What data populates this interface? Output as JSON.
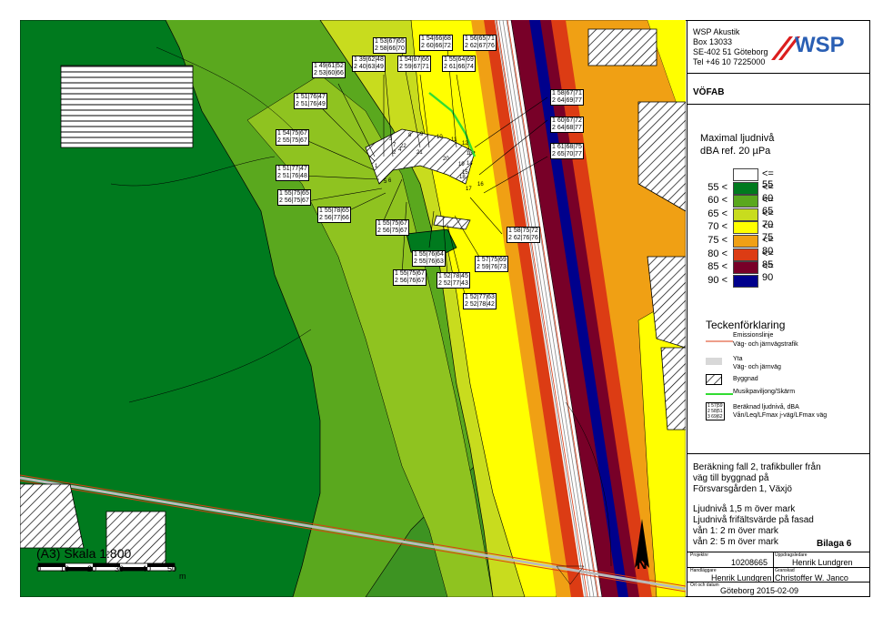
{
  "company": {
    "name": "WSP Akustik",
    "box": "Box 13033",
    "address": "SE-402 51 Göteborg",
    "phone": "Tel +46 10 7225000",
    "logo_text": "WSP"
  },
  "client": "VÖFAB",
  "legend": {
    "title_line1": "Maximal ljudnivå",
    "title_line2": "dBA ref. 20 µPa",
    "classes": [
      {
        "lower": "",
        "upper": "<= 55",
        "color": "#ffffff"
      },
      {
        "lower": "55 <",
        "upper": "<= 60",
        "color": "#007a1e"
      },
      {
        "lower": "60 <",
        "upper": "<= 65",
        "color": "#5aa81e"
      },
      {
        "lower": "65 <",
        "upper": "<= 70",
        "color": "#c8dc1e"
      },
      {
        "lower": "70 <",
        "upper": "<= 75",
        "color": "#ffff00"
      },
      {
        "lower": "75 <",
        "upper": "<= 80",
        "color": "#f0a014"
      },
      {
        "lower": "80 <",
        "upper": "<= 85",
        "color": "#dc3c14"
      },
      {
        "lower": "85 <",
        "upper": "<= 90",
        "color": "#780028"
      },
      {
        "lower": "90 <",
        "upper": "",
        "color": "#00008c"
      }
    ]
  },
  "symbols": {
    "title": "Teckenförklaring",
    "emission_line1": "Emissionslinje",
    "emission_line2": "Väg- och järnvägstrafik",
    "area_line1": "Yta",
    "area_line2": "Väg- och järnväg",
    "building": "Byggnad",
    "screen": "Musikpaviljong/Skärm",
    "calc_line1": "Beräknad ljudnivå, dBA",
    "calc_line2": "Vån/Leq/LFmax j-väg/LFmax väg",
    "calc_sample": [
      "1 57|59",
      "2 58|51",
      "3 69|62"
    ]
  },
  "description": {
    "line1": "Beräkning fall 2, trafikbuller från",
    "line2": "väg till byggnad på",
    "line3": "Försvarsgården 1, Växjö",
    "line4": "Ljudnivå 1,5 m över mark",
    "line5": "Ljudnivå frifältsvärde på fasad",
    "line6": "vån 1: 2 m över mark",
    "line7": "vån 2: 5 m över mark",
    "appendix": "Bilaga 6"
  },
  "titleblock": {
    "project_label": "Projektnr",
    "project": "10208665",
    "responsible_label": "Uppdragsledare",
    "responsible": "Henrik Lundgren",
    "handler_label": "Handläggare",
    "handler": "Henrik Lundgren",
    "reviewer_label": "Granskad",
    "reviewer": "Christoffer W. Janco",
    "place_label": "Ort och datum",
    "place_date": "Göteborg 2015-02-09"
  },
  "scale": {
    "label": "(A3) Skala 1:800",
    "ticks": [
      "0",
      "10",
      "20",
      "30",
      "40",
      "50"
    ],
    "unit": "m"
  },
  "north": "N",
  "map": {
    "contour_numbers": [
      "1",
      "2",
      "3",
      "4",
      "5",
      "6",
      "7",
      "8",
      "9",
      "10",
      "11",
      "12",
      "13",
      "14",
      "15",
      "16",
      "17",
      "18",
      "19",
      "20",
      "21",
      "22"
    ],
    "receivers": [
      {
        "rows": [
          "1 53|67|65",
          "2 58|66|70"
        ]
      },
      {
        "rows": [
          "1 54|66|68",
          "2 60|66|72"
        ]
      },
      {
        "rows": [
          "1 56|65|71",
          "2 62|67|76"
        ]
      },
      {
        "rows": [
          "1 39|62|48",
          "2 40|63|49"
        ]
      },
      {
        "rows": [
          "1 54|67|66",
          "2 59|67|71"
        ]
      },
      {
        "rows": [
          "1 55|64|69",
          "2 61|66|74"
        ]
      },
      {
        "rows": [
          "1 49|61|52",
          "2 53|60|66"
        ]
      },
      {
        "rows": [
          "1 51|76|47",
          "2 51|76|49"
        ]
      },
      {
        "rows": [
          "1 58|67|71",
          "2 64|69|77"
        ]
      },
      {
        "rows": [
          "1 60|67|72",
          "2 64|68|77"
        ]
      },
      {
        "rows": [
          "1 54|75|67",
          "2 55|75|67"
        ]
      },
      {
        "rows": [
          "1 61|68|75",
          "2 65|70|77"
        ]
      },
      {
        "rows": [
          "1 51|77|47",
          "2 51|76|48"
        ]
      },
      {
        "rows": [
          "1 55|75|65",
          "2 56|75|67"
        ]
      },
      {
        "rows": [
          "1 55|78|65",
          "2 56|77|66"
        ]
      },
      {
        "rows": [
          "1 55|75|67",
          "2 56|75|67"
        ]
      },
      {
        "rows": [
          "1 58|75|72",
          "2 62|76|76"
        ]
      },
      {
        "rows": [
          "1 55|76|64",
          "2 55|76|63"
        ]
      },
      {
        "rows": [
          "1 57|75|69",
          "2 59|76|73"
        ]
      },
      {
        "rows": [
          "1 55|75|67",
          "2 56|76|67"
        ]
      },
      {
        "rows": [
          "1 52|78|45",
          "2 52|77|43"
        ]
      },
      {
        "rows": [
          "1 52|77|63",
          "2 52|78|42"
        ]
      }
    ]
  }
}
